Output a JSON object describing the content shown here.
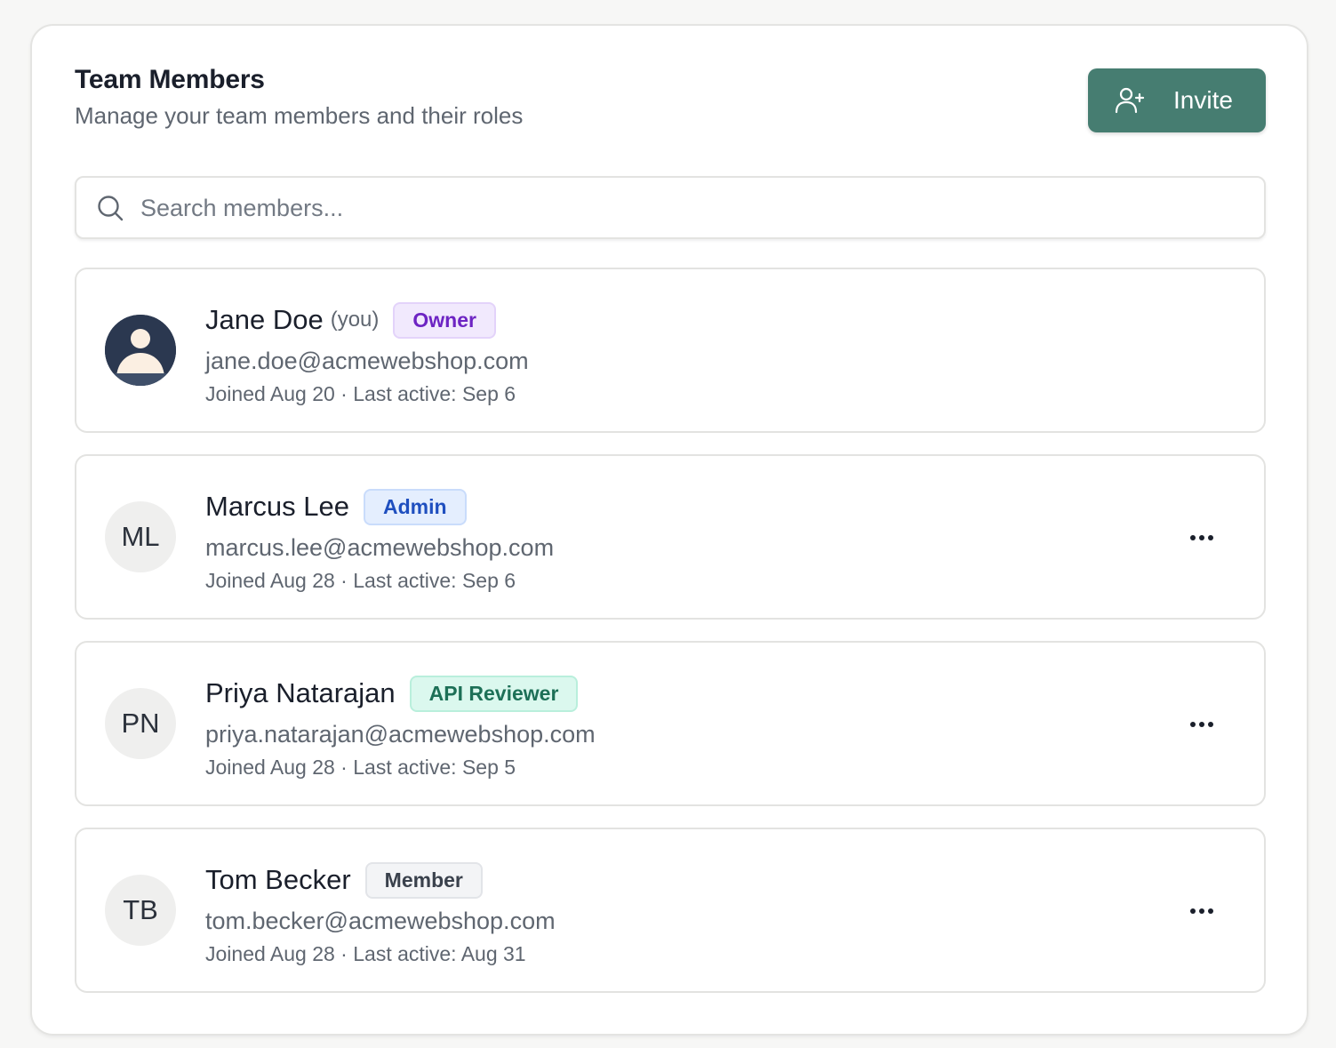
{
  "header": {
    "title": "Team Members",
    "subtitle": "Manage your team members and their roles",
    "invite_label": "Invite",
    "invite_icon": "user-plus-icon"
  },
  "search": {
    "placeholder": "Search members...",
    "value": "",
    "icon": "search-icon"
  },
  "members": [
    {
      "name": "Jane Doe",
      "you_label": "(you)",
      "role": "Owner",
      "role_colors": {
        "bg": "#f1e9fd",
        "border": "#e3d3fa",
        "text": "#6d24c3"
      },
      "email": "jane.doe@acmewebshop.com",
      "meta": "Joined Aug 20 · Last active: Sep 6",
      "avatar": "user-photo-icon"
    },
    {
      "name": "Marcus Lee",
      "role": "Admin",
      "role_colors": {
        "bg": "#e4eefe",
        "border": "#c9dcfb",
        "text": "#1f4fbf"
      },
      "email": "marcus.lee@acmewebshop.com",
      "meta": "Joined Aug 28 · Last active: Sep 6",
      "initials": "ML",
      "menu_icon": "more-horizontal-icon"
    },
    {
      "name": "Priya Natarajan",
      "role": "API Reviewer",
      "role_colors": {
        "bg": "#dbf8ee",
        "border": "#b9efdc",
        "text": "#1d7057"
      },
      "email": "priya.natarajan@acmewebshop.com",
      "meta": "Joined Aug 28 · Last active: Sep 5",
      "initials": "PN",
      "menu_icon": "more-horizontal-icon"
    },
    {
      "name": "Tom Becker",
      "role": "Member",
      "role_colors": {
        "bg": "#f3f4f6",
        "border": "#e2e4e8",
        "text": "#3a414c"
      },
      "email": "tom.becker@acmewebshop.com",
      "meta": "Joined Aug 28 · Last active: Aug 31",
      "initials": "TB",
      "menu_icon": "more-horizontal-icon"
    }
  ],
  "colors": {
    "accent": "#467d71",
    "text_primary": "#1a1f2b",
    "text_secondary": "#5f6670"
  }
}
